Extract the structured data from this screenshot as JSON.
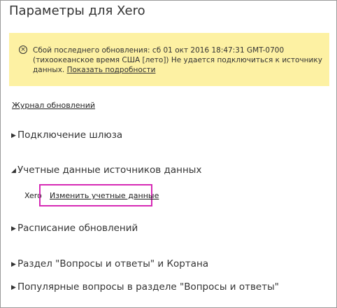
{
  "page": {
    "title": "Параметры для Xero"
  },
  "error_banner": {
    "icon": "error-circle-x-icon",
    "icon_glyph": "×",
    "message": "Сбой последнего обновления: сб 01 окт 2016 18:47:31 GMT-0700 (тихоокеанское время США [лето]) Не удается подключиться к источнику данных. ",
    "details_link": "Показать подробности",
    "background_color": "#fdf1a3"
  },
  "history_link": "Журнал обновлений",
  "sections": {
    "gateway": {
      "arrow": "▶",
      "label": "Подключение шлюза"
    },
    "credentials": {
      "arrow": "◢",
      "label": "Учетные данные источников данных",
      "source_name": "Xero",
      "edit_link": "Изменить учетные данные"
    },
    "schedule": {
      "arrow": "▶",
      "label": "Расписание обновлений"
    },
    "qna": {
      "arrow": "▶",
      "label": "Раздел \"Вопросы и ответы\" и Кортана"
    },
    "popular": {
      "arrow": "▶",
      "label": "Популярные вопросы в разделе \"Вопросы и ответы\""
    }
  },
  "highlight_color": "#d62ab5"
}
